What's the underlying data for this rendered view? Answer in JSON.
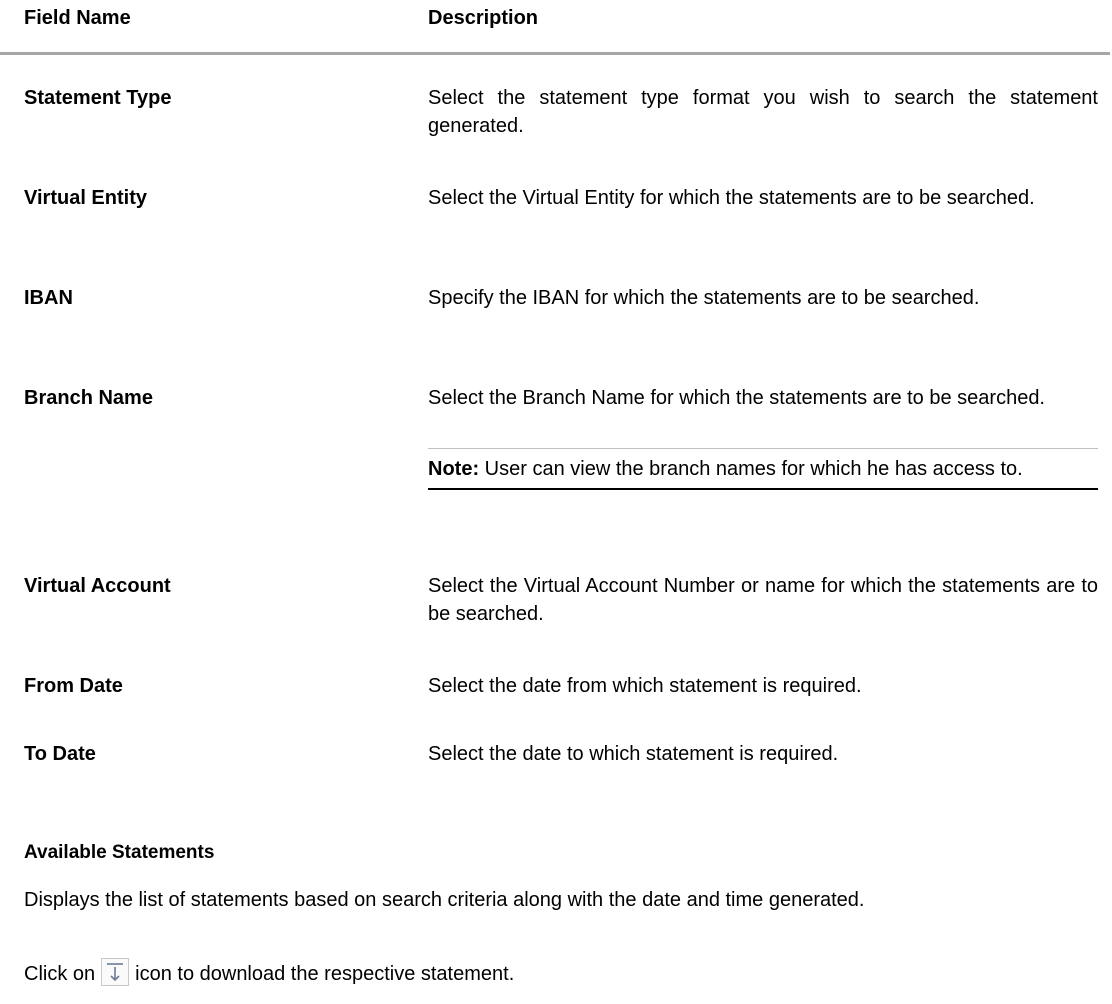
{
  "table": {
    "header_field": "Field Name",
    "header_description": "Description",
    "rows": [
      {
        "field": "Statement Type",
        "description": "Select the statement type format you wish to search the statement generated."
      },
      {
        "field": "Virtual Entity",
        "description": "Select the Virtual Entity for which the statements are to be searched."
      },
      {
        "field": "IBAN",
        "description": "Specify the IBAN for which the statements are to be searched."
      },
      {
        "field": "Branch Name",
        "description": "Select the Branch Name for which the statements are to be searched."
      },
      {
        "field": "Virtual Account",
        "description": "Select the Virtual Account Number or name for which the statements are to be searched."
      },
      {
        "field": "From Date",
        "description": "Select the date from which statement is required."
      },
      {
        "field": "To Date",
        "description": "Select the date to which statement is required."
      }
    ],
    "note": {
      "label": "Note:",
      "text": " User can view the branch names for which he has access to."
    }
  },
  "available": {
    "title": "Available Statements",
    "description": "Displays the list of statements based on search criteria along with the date and time generated.",
    "click_prefix": "Click on",
    "click_suffix": "icon to download the respective statement.",
    "icon": "download-icon"
  }
}
